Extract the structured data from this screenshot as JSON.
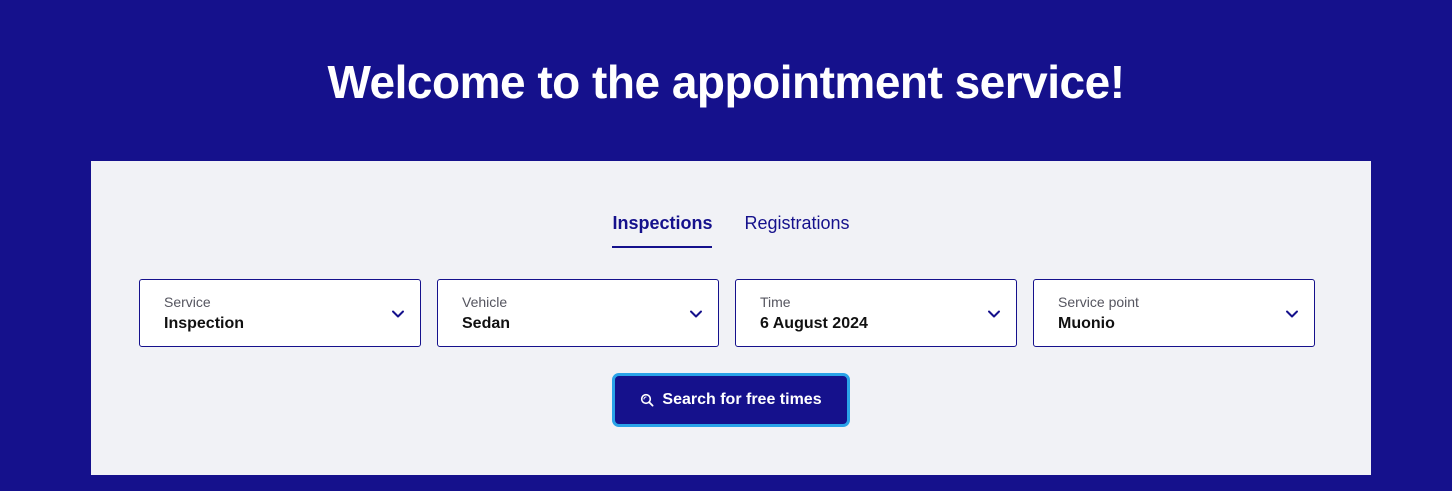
{
  "hero": {
    "title": "Welcome to the appointment service!"
  },
  "tabs": [
    {
      "label": "Inspections",
      "active": true
    },
    {
      "label": "Registrations",
      "active": false
    }
  ],
  "fields": [
    {
      "label": "Service",
      "value": "Inspection",
      "icon": "chevron-down-icon"
    },
    {
      "label": "Vehicle",
      "value": "Sedan",
      "icon": "chevron-down-icon"
    },
    {
      "label": "Time",
      "value": "6 August 2024",
      "icon": "chevron-down-icon"
    },
    {
      "label": "Service point",
      "value": "Muonio",
      "icon": "chevron-down-icon"
    }
  ],
  "search": {
    "button_label": "Search for free times",
    "icon": "search-icon"
  },
  "colors": {
    "brand": "#15118c",
    "panel_background": "#f1f2f6",
    "focus_ring": "#2aa3e8"
  }
}
